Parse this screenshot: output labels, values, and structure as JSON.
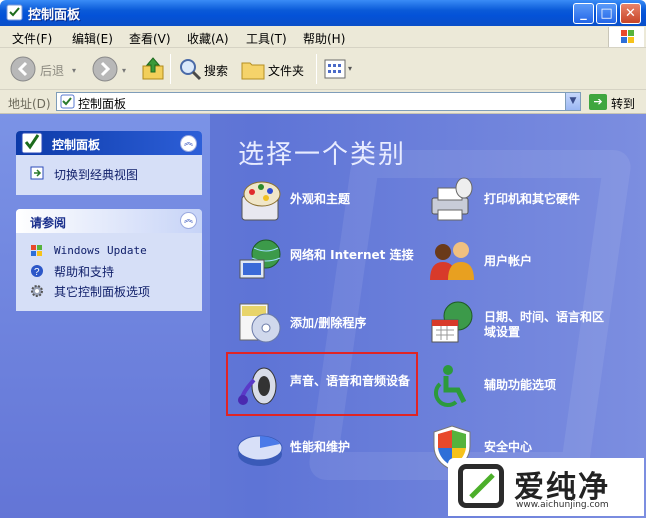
{
  "window": {
    "title": "控制面板",
    "min": "_",
    "max": "□",
    "close": "✕"
  },
  "menu": {
    "items": [
      "文件(F)",
      "编辑(E)",
      "查看(V)",
      "收藏(A)",
      "工具(T)",
      "帮助(H)"
    ]
  },
  "toolbar": {
    "back": "后退",
    "search": "搜索",
    "folders": "文件夹"
  },
  "address": {
    "label": "地址(D)",
    "value": "控制面板",
    "go": "转到"
  },
  "sidebar": {
    "panel1": {
      "title": "控制面板",
      "item": "切换到经典视图"
    },
    "panel2": {
      "title": "请参阅",
      "items": [
        "Windows Update",
        "帮助和支持",
        "其它控制面板选项"
      ]
    }
  },
  "main": {
    "heading": "选择一个类别",
    "categories": [
      {
        "label": "外观和主题",
        "icon": "appearance-icon"
      },
      {
        "label": "打印机和其它硬件",
        "icon": "printer-icon"
      },
      {
        "label": "网络和 Internet 连接",
        "icon": "network-icon"
      },
      {
        "label": "用户帐户",
        "icon": "users-icon"
      },
      {
        "label": "添加/删除程序",
        "icon": "add-remove-icon"
      },
      {
        "label": "日期、时间、语言和区域设置",
        "icon": "date-time-icon"
      },
      {
        "label": "声音、语音和音频设备",
        "icon": "sound-icon"
      },
      {
        "label": "辅助功能选项",
        "icon": "accessibility-icon"
      },
      {
        "label": "性能和维护",
        "icon": "performance-icon"
      },
      {
        "label": "安全中心",
        "icon": "security-icon"
      }
    ]
  },
  "watermark": {
    "brand": "爱纯净",
    "url": "www.aichunjing.com"
  }
}
